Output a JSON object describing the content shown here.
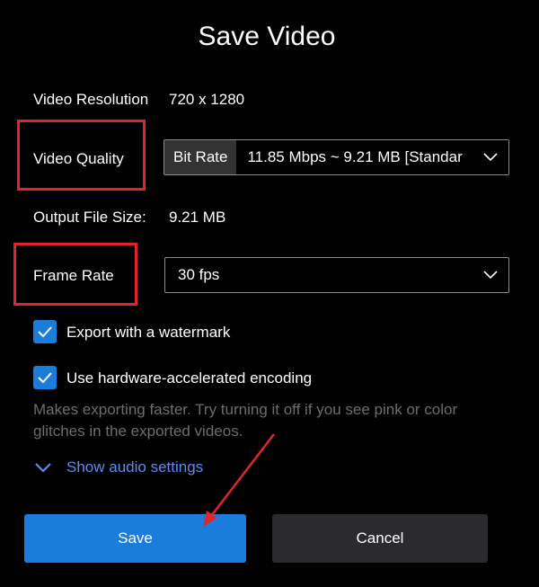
{
  "dialog": {
    "title": "Save Video"
  },
  "resolution": {
    "label": "Video Resolution",
    "value": "720 x 1280"
  },
  "quality": {
    "label": "Video Quality",
    "tag": "Bit Rate",
    "value": "11.85 Mbps ~ 9.21 MB [Standar"
  },
  "output_size": {
    "label": "Output File Size:",
    "value": "9.21 MB"
  },
  "frame_rate": {
    "label": "Frame Rate",
    "value": "30 fps"
  },
  "options": {
    "watermark_label": "Export with a watermark",
    "watermark_checked": true,
    "hw_encoding_label": "Use hardware-accelerated encoding",
    "hw_encoding_checked": true,
    "hw_hint": "Makes exporting faster. Try turning it off if you see pink or color glitches in the exported videos."
  },
  "audio": {
    "toggle_label": "Show audio settings"
  },
  "buttons": {
    "save_label": "Save",
    "cancel_label": "Cancel"
  },
  "colors": {
    "background": "#000000",
    "accent": "#1a7ddc",
    "link": "#5b8def",
    "annotation_red": "#e0262c",
    "secondary_button": "#2b2b2e"
  },
  "icons": {
    "dropdown": "chevron-down-icon",
    "checkbox": "checkmark-icon",
    "expand": "chevron-down-icon"
  }
}
